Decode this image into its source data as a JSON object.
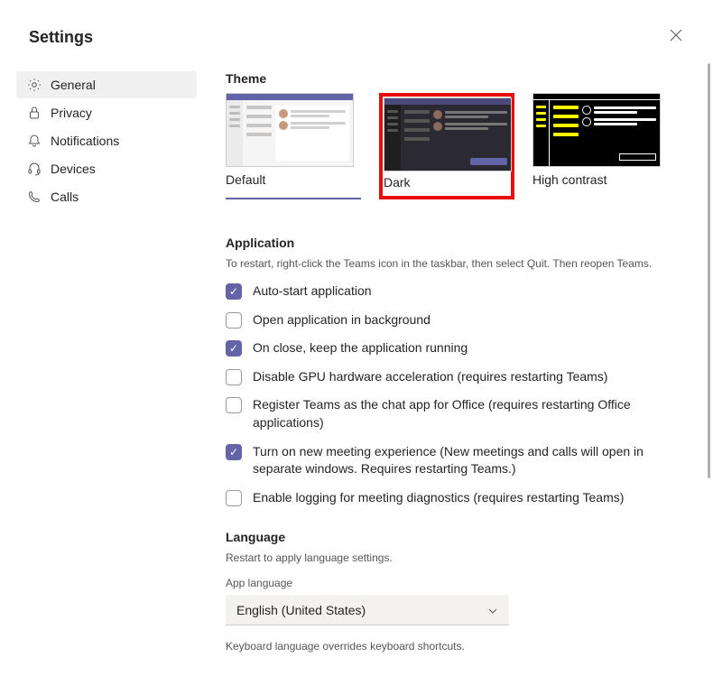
{
  "header": {
    "title": "Settings"
  },
  "sidebar": {
    "items": [
      {
        "label": "General",
        "icon": "gear-icon",
        "active": true
      },
      {
        "label": "Privacy",
        "icon": "lock-icon",
        "active": false
      },
      {
        "label": "Notifications",
        "icon": "bell-icon",
        "active": false
      },
      {
        "label": "Devices",
        "icon": "headset-icon",
        "active": false
      },
      {
        "label": "Calls",
        "icon": "phone-icon",
        "active": false
      }
    ]
  },
  "theme": {
    "heading": "Theme",
    "options": [
      {
        "label": "Default",
        "selected": true,
        "highlighted": false
      },
      {
        "label": "Dark",
        "selected": false,
        "highlighted": true
      },
      {
        "label": "High contrast",
        "selected": false,
        "highlighted": false
      }
    ]
  },
  "application": {
    "heading": "Application",
    "subtext": "To restart, right-click the Teams icon in the taskbar, then select Quit. Then reopen Teams.",
    "options": [
      {
        "checked": true,
        "label": "Auto-start application"
      },
      {
        "checked": false,
        "label": "Open application in background"
      },
      {
        "checked": true,
        "label": "On close, keep the application running"
      },
      {
        "checked": false,
        "label": "Disable GPU hardware acceleration (requires restarting Teams)"
      },
      {
        "checked": false,
        "label": "Register Teams as the chat app for Office (requires restarting Office applications)"
      },
      {
        "checked": true,
        "label": "Turn on new meeting experience (New meetings and calls will open in separate windows. Requires restarting Teams.)"
      },
      {
        "checked": false,
        "label": "Enable logging for meeting diagnostics (requires restarting Teams)"
      }
    ]
  },
  "language": {
    "heading": "Language",
    "subtext": "Restart to apply language settings.",
    "app_language_label": "App language",
    "app_language_value": "English (United States)",
    "keyboard_note": "Keyboard language overrides keyboard shortcuts."
  }
}
